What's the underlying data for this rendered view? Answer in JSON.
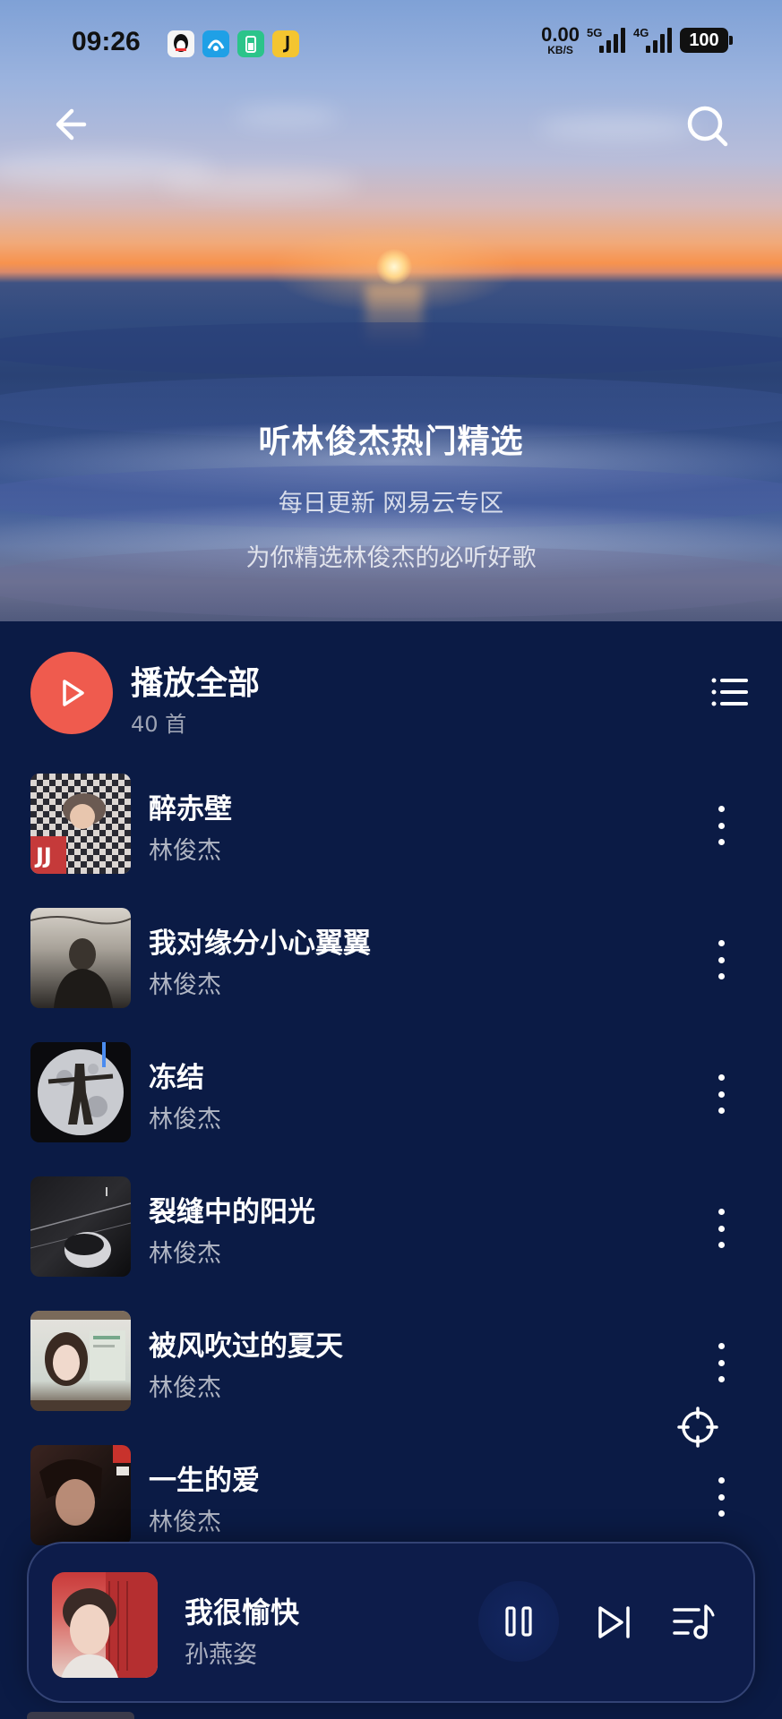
{
  "status_bar": {
    "time": "09:26",
    "net_speed_value": "0.00",
    "net_speed_unit": "KB/S",
    "signal_1": "5G",
    "signal_2": "4G",
    "battery": "100",
    "app_icons": [
      "qq-icon",
      "maps-icon",
      "battery-app-icon",
      "music-app-icon"
    ]
  },
  "header": {
    "back_icon": "arrow-left-icon",
    "search_icon": "search-icon"
  },
  "hero": {
    "title": "听林俊杰热门精选",
    "subtitle": "每日更新 网易云专区",
    "description": "为你精选林俊杰的必听好歌"
  },
  "play_all": {
    "label": "播放全部",
    "count": "40 首"
  },
  "songs": [
    {
      "title": "醉赤壁",
      "artist": "林俊杰"
    },
    {
      "title": "我对缘分小心翼翼",
      "artist": "林俊杰"
    },
    {
      "title": "冻结",
      "artist": "林俊杰"
    },
    {
      "title": "裂缝中的阳光",
      "artist": "林俊杰"
    },
    {
      "title": "被风吹过的夏天",
      "artist": "林俊杰"
    },
    {
      "title": "一生的爱",
      "artist": "林俊杰"
    }
  ],
  "now_playing": {
    "title": "我很愉快",
    "artist": "孙燕姿",
    "state": "playing"
  },
  "colors": {
    "accent": "#ef5b4e",
    "background": "#0b1b45"
  }
}
